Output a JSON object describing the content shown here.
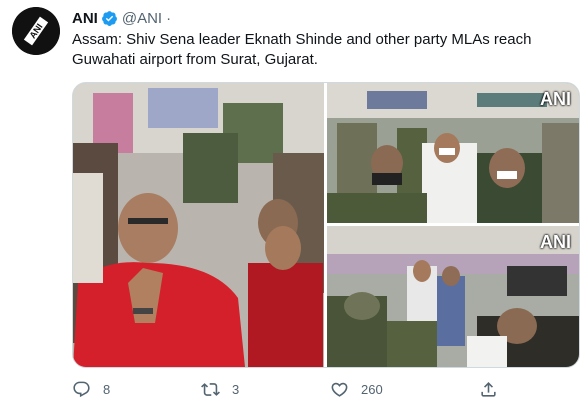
{
  "tweet": {
    "author_name": "ANI",
    "author_handle": "@ANI",
    "separator": "·",
    "text": "Assam: Shiv Sena leader Eknath Shinde and other party MLAs reach Guwahati airport from Surat, Gujarat.",
    "avatar_label": "ANI",
    "verified_icon": "verified-badge-icon",
    "verified_color": "#1d9bf0"
  },
  "media": {
    "watermark": "ANI",
    "photos": [
      {
        "name": "photo-main"
      },
      {
        "name": "photo-top-right"
      },
      {
        "name": "photo-bottom-right"
      }
    ]
  },
  "actions": {
    "reply_count": "8",
    "retweet_count": "3",
    "like_count": "260",
    "icons": [
      "reply-icon",
      "retweet-icon",
      "like-icon",
      "share-icon"
    ]
  }
}
